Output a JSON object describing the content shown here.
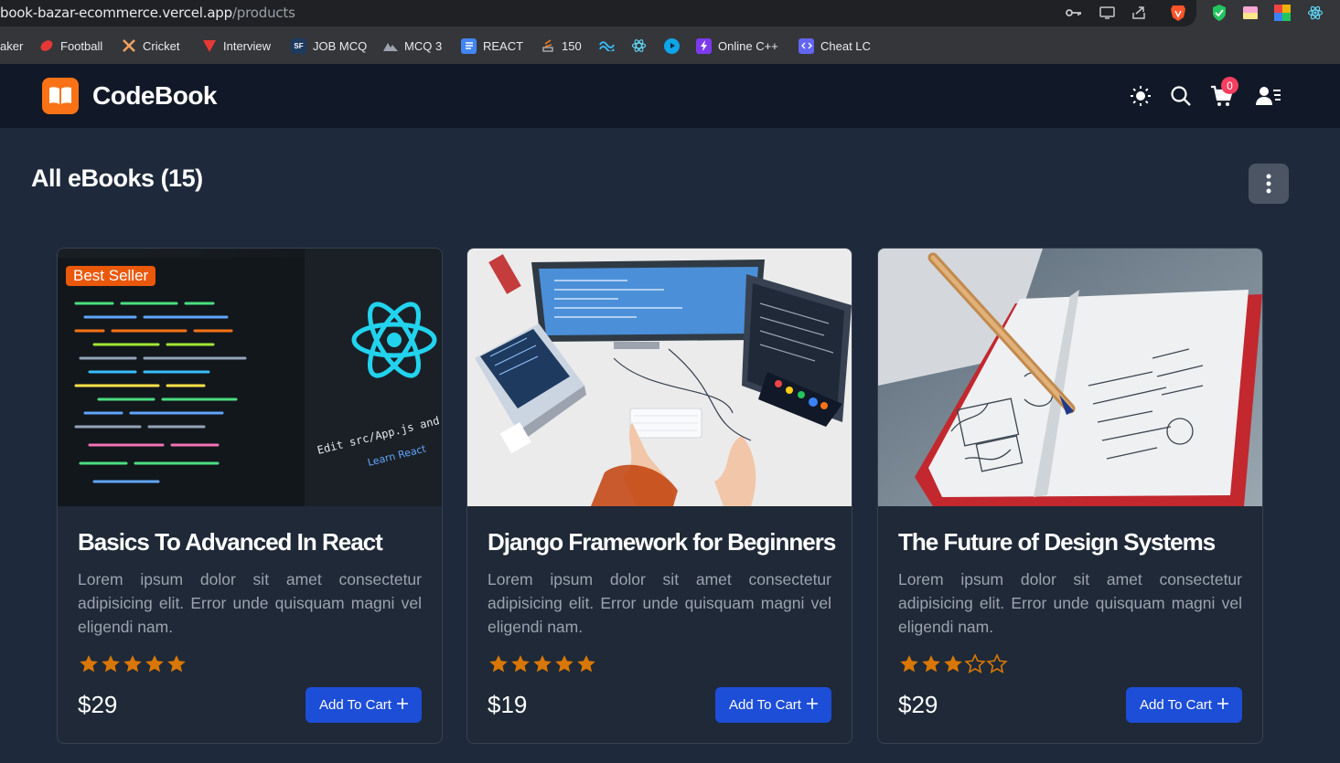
{
  "browser": {
    "url_host": "book-bazar-ecommerce.vercel.app",
    "url_path": "/products",
    "bookmarks": [
      {
        "label": "aker",
        "icon": "none"
      },
      {
        "label": "Football",
        "icon": "football-icon",
        "color": "#e53935"
      },
      {
        "label": "Cricket",
        "icon": "cricket-icon",
        "color": "#f4a261"
      },
      {
        "label": "Interview",
        "icon": "interview-icon",
        "color": "#e53935"
      },
      {
        "label": "JOB MCQ",
        "icon": "job-mcq-icon",
        "color": "#1e3a5f"
      },
      {
        "label": "MCQ 3",
        "icon": "mcq-icon",
        "color": "#9ca3af"
      },
      {
        "label": "REACT",
        "icon": "docs-icon",
        "color": "#4285f4"
      },
      {
        "label": "150",
        "icon": "stack-icon",
        "color": "#f48024"
      },
      {
        "label": "",
        "icon": "tailwind-icon",
        "color": "#38bdf8"
      },
      {
        "label": "",
        "icon": "react-icon",
        "color": "#61dafb"
      },
      {
        "label": "",
        "icon": "play-icon",
        "color": "#0ea5e9"
      },
      {
        "label": "Online C++",
        "icon": "bolt-icon",
        "color": "#7c3aed"
      },
      {
        "label": "Cheat LC",
        "icon": "code-icon",
        "color": "#6366f1"
      }
    ]
  },
  "header": {
    "brand": "CodeBook",
    "cart_count": "0"
  },
  "page": {
    "title": "All eBooks",
    "count": "(15)"
  },
  "products": [
    {
      "title": "Basics To Advanced In React",
      "description": "Lorem ipsum dolor sit amet consectetur adipisicing elit. Error unde quisquam magni vel eligendi nam.",
      "rating": 5,
      "price": "$29",
      "badge": "Best Seller",
      "button": "Add To Cart",
      "image": "react-code-screen"
    },
    {
      "title": "Django Framework for Beginners",
      "description": "Lorem ipsum dolor sit amet consectetur adipisicing elit. Error unde quisquam magni vel eligendi nam.",
      "rating": 5,
      "price": "$19",
      "badge": "",
      "button": "Add To Cart",
      "image": "desk-workstation"
    },
    {
      "title": "The Future of Design Systems",
      "description": "Lorem ipsum dolor sit amet consectetur adipisicing elit. Error unde quisquam magni vel eligendi nam.",
      "rating": 3,
      "price": "$29",
      "badge": "",
      "button": "Add To Cart",
      "image": "sketch-notebook"
    }
  ],
  "colors": {
    "page_bg": "#1e293b",
    "header_bg": "#111827",
    "accent_orange": "#f97316",
    "button_blue": "#1d4ed8",
    "star": "#d97706",
    "badge_red": "#f43f5e"
  }
}
